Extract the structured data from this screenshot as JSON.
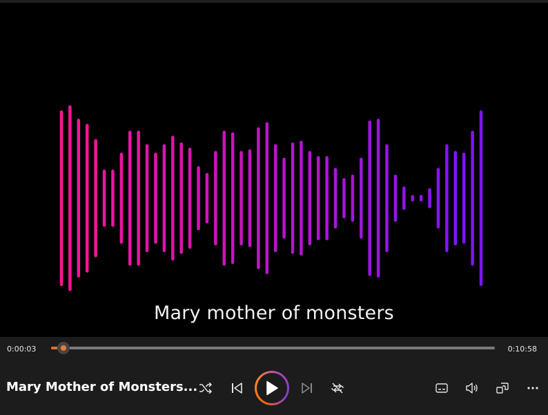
{
  "video": {
    "caption": "Mary mother of monsters",
    "visualizer": {
      "color_start": "#ff1493",
      "color_end": "#7a14ff",
      "bars": [
        0.51,
        0.54,
        0.46,
        0.43,
        0.34,
        0.16,
        0.16,
        0.26,
        0.39,
        0.39,
        0.31,
        0.26,
        0.31,
        0.36,
        0.32,
        0.29,
        0.18,
        0.14,
        0.27,
        0.39,
        0.38,
        0.27,
        0.28,
        0.41,
        0.44,
        0.31,
        0.23,
        0.32,
        0.33,
        0.27,
        0.24,
        0.24,
        0.17,
        0.11,
        0.13,
        0.23,
        0.45,
        0.46,
        0.31,
        0.13,
        0.06,
        0.01,
        0.01,
        0.05,
        0.17,
        0.31,
        0.27,
        0.26,
        0.39,
        0.51
      ]
    }
  },
  "player": {
    "current_time": "0:00:03",
    "total_time": "0:10:58",
    "progress": 0.014,
    "accent": "#f07a2c",
    "title": "Mary Mother of Monsters..."
  },
  "icons": {
    "shuffle": "shuffle-icon",
    "previous": "previous-icon",
    "play": "play-icon",
    "next": "next-icon",
    "repeat": "repeat-icon",
    "captions": "captions-icon",
    "volume": "volume-icon",
    "miniplayer": "miniplayer-icon",
    "more": "more-icon"
  }
}
